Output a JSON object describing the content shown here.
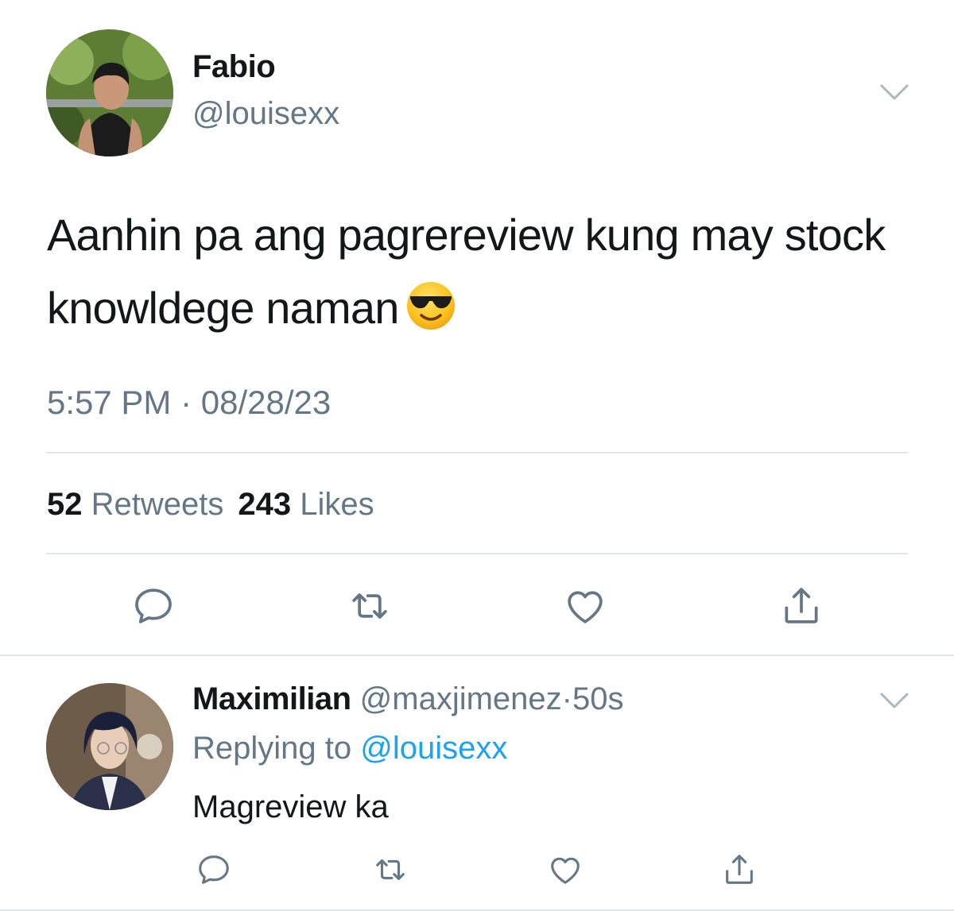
{
  "main_tweet": {
    "author_name": "Fabio",
    "author_handle": "@louisexx",
    "text": "Aanhin pa ang pagrereview kung may stock knowldege naman",
    "emoji": "smiling-face-with-sunglasses",
    "timestamp": "5:57 PM · 08/28/23",
    "stats": {
      "retweets_count": "52",
      "retweets_label": "Retweets",
      "likes_count": "243",
      "likes_label": "Likes"
    },
    "actions": [
      "reply-icon",
      "retweet-icon",
      "like-icon",
      "share-icon"
    ]
  },
  "reply_tweet": {
    "author_name": "Maximilian",
    "author_handle": "@maxjimenez",
    "separator": "·",
    "time_ago": "50s",
    "replying_prefix": "Replying to",
    "replying_to": "@louisexx",
    "text": "Magreview ka",
    "actions": [
      "reply-icon",
      "retweet-icon",
      "like-icon",
      "share-icon"
    ]
  },
  "colors": {
    "text_primary": "#14171a",
    "text_secondary": "#657786",
    "link": "#1da1f2",
    "divider": "#e1e8ed",
    "icon": "#657786"
  }
}
